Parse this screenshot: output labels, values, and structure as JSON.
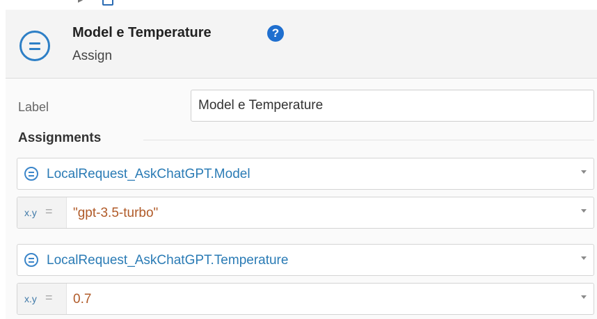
{
  "node": {
    "title": "Model e Temperature",
    "type": "Assign",
    "icon": "assign-icon"
  },
  "help": {
    "symbol": "?",
    "icon": "help-icon"
  },
  "properties": {
    "label_caption": "Label",
    "label_value": "Model e Temperature"
  },
  "assignments": {
    "section_title": "Assignments",
    "expression_badge": "x.y",
    "equals_sign": "=",
    "items": [
      {
        "variable": "LocalRequest_AskChatGPT.Model",
        "value": "\"gpt-3.5-turbo\""
      },
      {
        "variable": "LocalRequest_AskChatGPT.Temperature",
        "value": "0.7"
      }
    ]
  },
  "colors": {
    "accent": "#2d7fc6",
    "help": "#1f6fcf",
    "variable_text": "#2a7bb5",
    "value_text": "#b05a28"
  }
}
